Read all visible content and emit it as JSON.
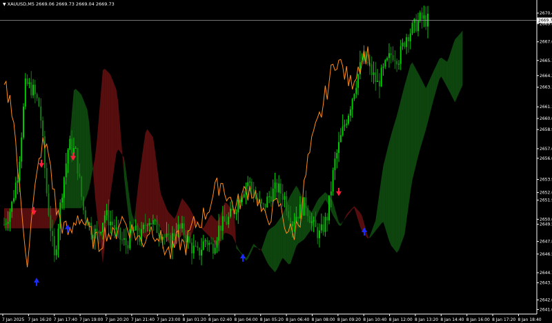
{
  "window": {
    "title": "XAUUSD,M5  2669.06 2669.73 2669.04 2669.73",
    "menu_icon": "triangle-down-icon"
  },
  "colors": {
    "background": "#000000",
    "bull_candle": "#00cc00",
    "bear_candle": "#1a7a1a",
    "price_line": "#ff8c1a",
    "kumo_bull": "#1f9a1f",
    "kumo_bear": "#c02020",
    "sell_arrow": "#ff1e3c",
    "buy_arrow": "#1a2cff",
    "axis": "#ffffff"
  },
  "chart_data": {
    "type": "candlestick",
    "symbol": "XAUUSD",
    "timeframe": "M5",
    "current_price": "2669.73",
    "y_ticks": [
      "2670.45",
      "2669.40",
      "2667.60",
      "2665.75",
      "2664.25",
      "2663.10",
      "2661.15",
      "2660.00",
      "2658.90",
      "2657.00",
      "2656.05",
      "2653.95",
      "2652.65",
      "2651.90",
      "2650.00",
      "2649.50",
      "2647.80",
      "2646.55",
      "2644.70",
      "2643.70",
      "2642.00",
      "2641.05"
    ],
    "x_ticks": [
      "7 Jan 2025",
      "7 Jan 16:20",
      "7 Jan 17:40",
      "7 Jan 19:00",
      "7 Jan 20:20",
      "7 Jan 21:40",
      "7 Jan 23:00",
      "8 Jan 01:20",
      "8 Jan 02:40",
      "8 Jan 04:00",
      "8 Jan 05:20",
      "8 Jan 06:40",
      "8 Jan 08:00",
      "8 Jan 09:20",
      "8 Jan 10:40",
      "8 Jan 12:00",
      "8 Jan 13:20",
      "8 Jan 14:40",
      "8 Jan 16:00",
      "8 Jan 17:20",
      "8 Jan 18:40"
    ],
    "close_profile": [
      2649.5,
      2651.2,
      2655.0,
      2663.5,
      2662.8,
      2661.0,
      2652.0,
      2646.0,
      2652.5,
      2657.5,
      2656.5,
      2651.0,
      2649.2,
      2648.4,
      2650.5,
      2649.6,
      2648.2,
      2647.5,
      2648.9,
      2648.1,
      2650.2,
      2649.3,
      2648.6,
      2647.6,
      2649.1,
      2648.8,
      2647.3,
      2646.5,
      2648.0,
      2647.2,
      2649.3,
      2649.8,
      2650.8,
      2652.6,
      2653.8,
      2652.2,
      2651.0,
      2652.4,
      2653.1,
      2652.3,
      2649.8,
      2650.7,
      2651.6,
      2649.3,
      2648.4,
      2650.3,
      2655.5,
      2658.4,
      2660.8,
      2663.6,
      2666.1,
      2664.8,
      2663.4,
      2665.0,
      2666.5,
      2666.0,
      2668.2,
      2669.0,
      2669.9,
      2669.7
    ],
    "signals": [
      {
        "type": "sell",
        "time": "7 Jan 17:00",
        "price": "2655.3"
      },
      {
        "type": "sell",
        "time": "7 Jan 16:40",
        "price": "2650.6"
      },
      {
        "type": "sell",
        "time": "7 Jan 19:10",
        "price": "2656.0"
      },
      {
        "type": "buy",
        "time": "7 Jan 16:50",
        "price": "2644.0"
      },
      {
        "type": "buy",
        "time": "7 Jan 18:50",
        "price": "2649.3"
      },
      {
        "type": "buy",
        "time": "8 Jan 06:45",
        "price": "2646.4"
      },
      {
        "type": "sell",
        "time": "8 Jan 13:20",
        "price": "2652.5"
      },
      {
        "type": "buy",
        "time": "8 Jan 14:50",
        "price": "2649.0"
      }
    ]
  }
}
